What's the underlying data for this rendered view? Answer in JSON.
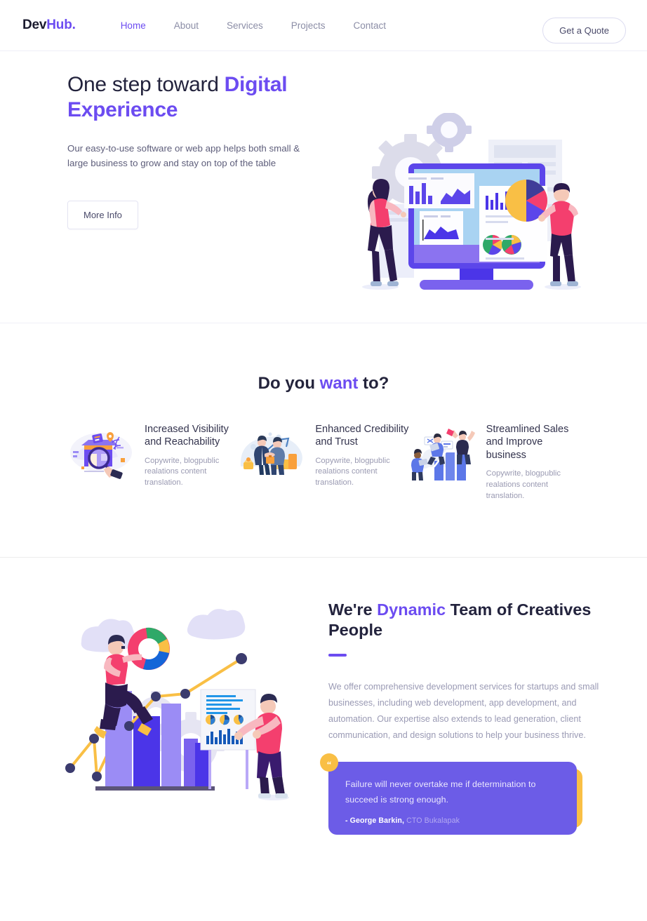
{
  "brand": {
    "name_dark": "Dev",
    "name_accent": "Hub."
  },
  "nav": {
    "links": [
      {
        "label": "Home",
        "active": true
      },
      {
        "label": "About",
        "active": false
      },
      {
        "label": "Services",
        "active": false
      },
      {
        "label": "Projects",
        "active": false
      },
      {
        "label": "Contact",
        "active": false
      }
    ],
    "cta_label": "Get a Quote"
  },
  "hero": {
    "title_plain": "One step toward ",
    "title_accent": "Digital Experience",
    "subtitle": "Our easy-to-use software or web app helps both small & large business to grow and stay on top of the table",
    "button_label": "More Info",
    "illustration": "data-analytics-dashboard-illustration"
  },
  "want_section": {
    "title_pre": "Do you ",
    "title_accent": "want",
    "title_post": " to?",
    "cards": [
      {
        "title": "Increased Visibility and Reachability",
        "desc": "Copywrite, blogpublic realations content translation.",
        "illustration": "magnifying-glass-storefront-icon"
      },
      {
        "title": "Enhanced Credibility and Trust",
        "desc": "Copywrite, blogpublic realations content translation.",
        "illustration": "handshake-coins-icon"
      },
      {
        "title": "Streamlined Sales and Improve business",
        "desc": "Copywrite, blogpublic realations content translation.",
        "illustration": "growth-bar-chart-people-icon"
      }
    ]
  },
  "dynamic_section": {
    "title_pre": "We're ",
    "title_accent": "Dynamic",
    "title_post": " Team of Creatives People",
    "body": "We offer comprehensive development services for startups and small businesses, including web development, app development, and automation. Our expertise also extends to lead generation, client communication, and design solutions to help your business thrive.",
    "illustration": "team-analytics-bar-chart-illustration",
    "quote": {
      "mark": "“",
      "text": "Failure will never overtake me if determination to succeed is strong enough.",
      "author": "- George Barkin,",
      "role": " CTO Bukalapak"
    }
  },
  "colors": {
    "accent_purple": "#6c4cf1",
    "quote_purple": "#6c5ce7",
    "quote_shadow_yellow": "#f9bf45",
    "text_dark": "#23233d",
    "text_muted": "#9a9ab4",
    "pink": "#f43f6e",
    "orange": "#f9a03c",
    "light_purple": "#9b8cf5",
    "deep_blue": "#4b35e8"
  }
}
